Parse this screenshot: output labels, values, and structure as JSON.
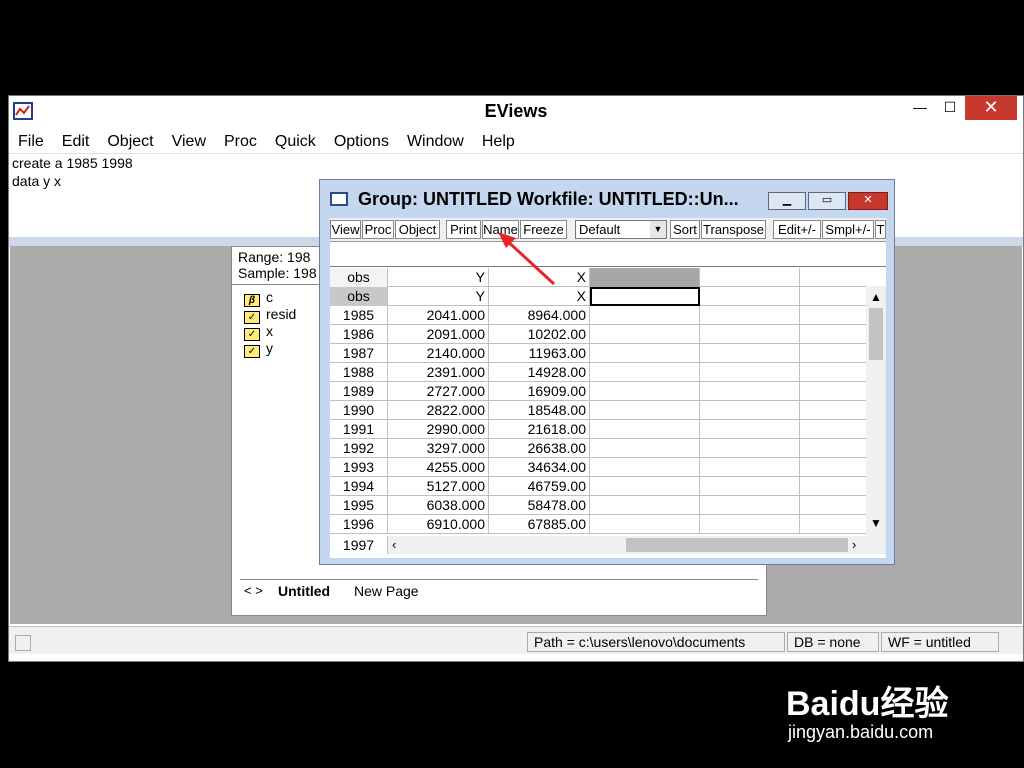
{
  "app": {
    "title": "EViews",
    "window_controls": {
      "minimize": "—",
      "maximize": "☐",
      "close": "✕"
    }
  },
  "menu": [
    "File",
    "Edit",
    "Object",
    "View",
    "Proc",
    "Quick",
    "Options",
    "Window",
    "Help"
  ],
  "command": {
    "lines": [
      "create a 1985 1998",
      "data y x"
    ]
  },
  "workfile": {
    "range_label": "Range:  198",
    "sample_label": "Sample: 198",
    "objects": [
      {
        "icon": "beta",
        "label": "c"
      },
      {
        "icon": "series",
        "label": "resid"
      },
      {
        "icon": "series",
        "label": "x"
      },
      {
        "icon": "series",
        "label": "y"
      }
    ],
    "tabs": {
      "nav": "< >",
      "active": "Untitled",
      "new": "New Page"
    }
  },
  "group": {
    "title": "Group: UNTITLED   Workfile: UNTITLED::Un...",
    "toolbar": [
      "View",
      "Proc",
      "Object",
      "Print",
      "Name",
      "Freeze",
      "Sort",
      "Transpose",
      "Edit+/-",
      "Smpl+/-",
      "T"
    ],
    "view_select": "Default",
    "header": {
      "obs": "obs",
      "y": "Y",
      "x": "X"
    },
    "rows": [
      {
        "obs": "1985",
        "y": "2041.000",
        "x": "8964.000"
      },
      {
        "obs": "1986",
        "y": "2091.000",
        "x": "10202.00"
      },
      {
        "obs": "1987",
        "y": "2140.000",
        "x": "11963.00"
      },
      {
        "obs": "1988",
        "y": "2391.000",
        "x": "14928.00"
      },
      {
        "obs": "1989",
        "y": "2727.000",
        "x": "16909.00"
      },
      {
        "obs": "1990",
        "y": "2822.000",
        "x": "18548.00"
      },
      {
        "obs": "1991",
        "y": "2990.000",
        "x": "21618.00"
      },
      {
        "obs": "1992",
        "y": "3297.000",
        "x": "26638.00"
      },
      {
        "obs": "1993",
        "y": "4255.000",
        "x": "34634.00"
      },
      {
        "obs": "1994",
        "y": "5127.000",
        "x": "46759.00"
      },
      {
        "obs": "1995",
        "y": "6038.000",
        "x": "58478.00"
      },
      {
        "obs": "1996",
        "y": "6910.000",
        "x": "67885.00"
      }
    ],
    "last_obs": "1997"
  },
  "status": {
    "path": "Path = c:\\users\\lenovo\\documents",
    "db": "DB = none",
    "wf": "WF = untitled"
  },
  "watermark": {
    "logo": "Baidu经验",
    "url": "jingyan.baidu.com"
  },
  "colors": {
    "accent_arrow": "#e8262a",
    "window_frame": "#c5d7ee",
    "close_red": "#c7382e"
  }
}
